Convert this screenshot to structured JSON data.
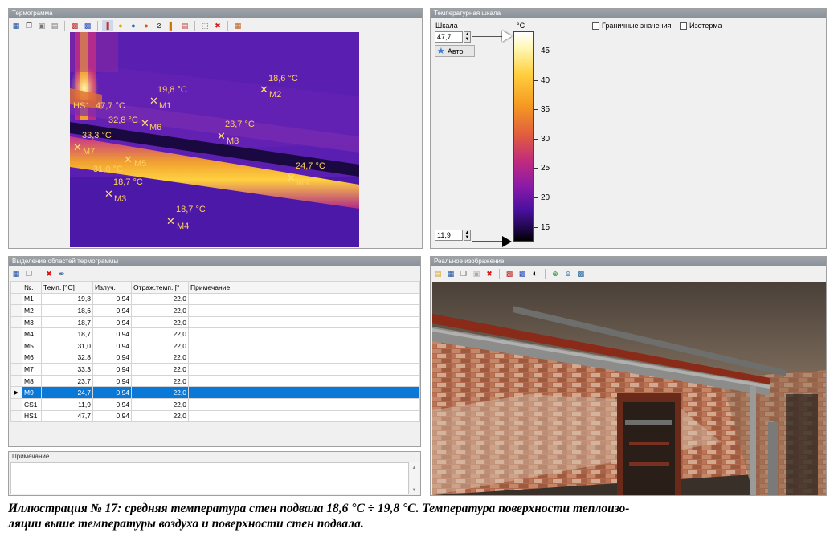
{
  "thermogram_panel": {
    "title": "Термограмма",
    "markers": [
      {
        "name": "M1",
        "temp": "19,8 °C"
      },
      {
        "name": "M2",
        "temp": "18,6 °C"
      },
      {
        "name": "M3",
        "temp": "18,7 °C"
      },
      {
        "name": "M4",
        "temp": "18,7 °C"
      },
      {
        "name": "M5",
        "temp": "31,0 °C"
      },
      {
        "name": "M6",
        "temp": "32,8 °C"
      },
      {
        "name": "M7",
        "temp": "33,3 °C"
      },
      {
        "name": "M8",
        "temp": "23,7 °C"
      },
      {
        "name": "M9",
        "temp": "24,7 °C"
      },
      {
        "name": "HS1",
        "temp": "47,7 °C"
      }
    ]
  },
  "scale_panel": {
    "title": "Температурная шкала",
    "scale_label": "Шкала",
    "max_value": "47,7",
    "min_value": "11,9",
    "auto_button": "Авто",
    "unit": "°C",
    "ticks": [
      "45",
      "40",
      "35",
      "30",
      "25",
      "20",
      "15"
    ],
    "boundary_label": "Граничные значения",
    "isotherm_label": "Изотерма"
  },
  "regions_panel": {
    "title": "Выделение областей термограммы",
    "columns": [
      "№.",
      "Темп. [°C]",
      "Излуч.",
      "Отраж.темп. [°",
      "Примечание"
    ],
    "selected_row": 8,
    "rows": [
      {
        "id": "M1",
        "temp": "19,8",
        "emis": "0,94",
        "refl": "22,0"
      },
      {
        "id": "M2",
        "temp": "18,6",
        "emis": "0,94",
        "refl": "22,0"
      },
      {
        "id": "M3",
        "temp": "18,7",
        "emis": "0,94",
        "refl": "22,0"
      },
      {
        "id": "M4",
        "temp": "18,7",
        "emis": "0,94",
        "refl": "22,0"
      },
      {
        "id": "M5",
        "temp": "31,0",
        "emis": "0,94",
        "refl": "22,0"
      },
      {
        "id": "M6",
        "temp": "32,8",
        "emis": "0,94",
        "refl": "22,0"
      },
      {
        "id": "M7",
        "temp": "33,3",
        "emis": "0,94",
        "refl": "22,0"
      },
      {
        "id": "M8",
        "temp": "23,7",
        "emis": "0,94",
        "refl": "22,0"
      },
      {
        "id": "M9",
        "temp": "24,7",
        "emis": "0,94",
        "refl": "22,0"
      },
      {
        "id": "CS1",
        "temp": "11,9",
        "emis": "0,94",
        "refl": "22,0"
      },
      {
        "id": "HS1",
        "temp": "47,7",
        "emis": "0,94",
        "refl": "22,0"
      }
    ]
  },
  "note_panel": {
    "title": "Примечание"
  },
  "photo_panel": {
    "title": "Реальное изображение"
  },
  "caption": {
    "line1": "Иллюстрация № 17: средняя температура стен подвала 18,6 °С ÷ 19,8 °С. Температура поверхности теплоизо-",
    "line2": "ляции выше температуры воздуха и поверхности стен подвала."
  },
  "colors": {
    "selection": "#0a78d7",
    "marker": "#ffd060",
    "thermo_bg": "#5a1fb0"
  },
  "icons": [
    "save-icon",
    "copy-icon",
    "delete-icon",
    "palette-icon",
    "zoom-in-icon",
    "zoom-out-icon"
  ]
}
